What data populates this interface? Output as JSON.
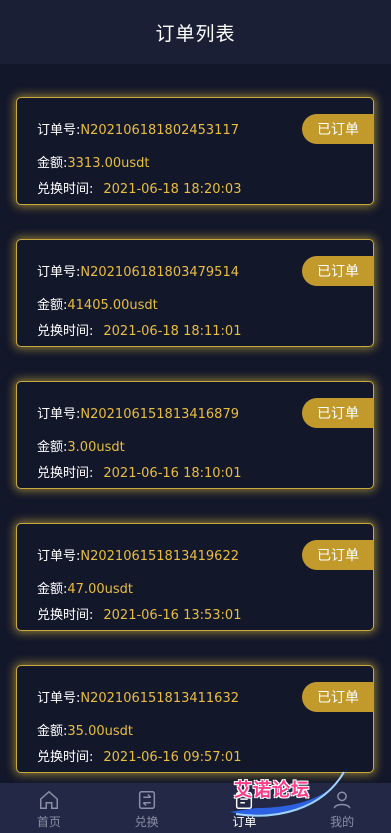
{
  "header": {
    "title": "订单列表"
  },
  "labels": {
    "order_no": "订单号:",
    "amount": "金额:",
    "redeem_time": "兑换时间:"
  },
  "orders": [
    {
      "order_no": "N202106181802453117",
      "amount": "3313.00usdt",
      "time": "2021-06-18 18:20:03",
      "status": "已订单"
    },
    {
      "order_no": "N202106181803479514",
      "amount": "41405.00usdt",
      "time": "2021-06-18 18:11:01",
      "status": "已订单"
    },
    {
      "order_no": "N202106151813416879",
      "amount": "3.00usdt",
      "time": "2021-06-16 18:10:01",
      "status": "已订单"
    },
    {
      "order_no": "N202106151813419622",
      "amount": "47.00usdt",
      "time": "2021-06-16 13:53:01",
      "status": "已订单"
    },
    {
      "order_no": "N202106151813411632",
      "amount": "35.00usdt",
      "time": "2021-06-16 09:57:01",
      "status": "已订单"
    }
  ],
  "tabbar": {
    "items": [
      {
        "label": "首页",
        "icon": "home-icon",
        "active": false
      },
      {
        "label": "兑换",
        "icon": "exchange-icon",
        "active": false
      },
      {
        "label": "订单",
        "icon": "order-icon",
        "active": true
      },
      {
        "label": "我的",
        "icon": "user-icon",
        "active": false
      }
    ]
  },
  "watermark": {
    "text": "艾诺论坛"
  },
  "colors": {
    "accent": "#e8bd42",
    "badge": "#c29a2c",
    "background": "#13172a"
  }
}
